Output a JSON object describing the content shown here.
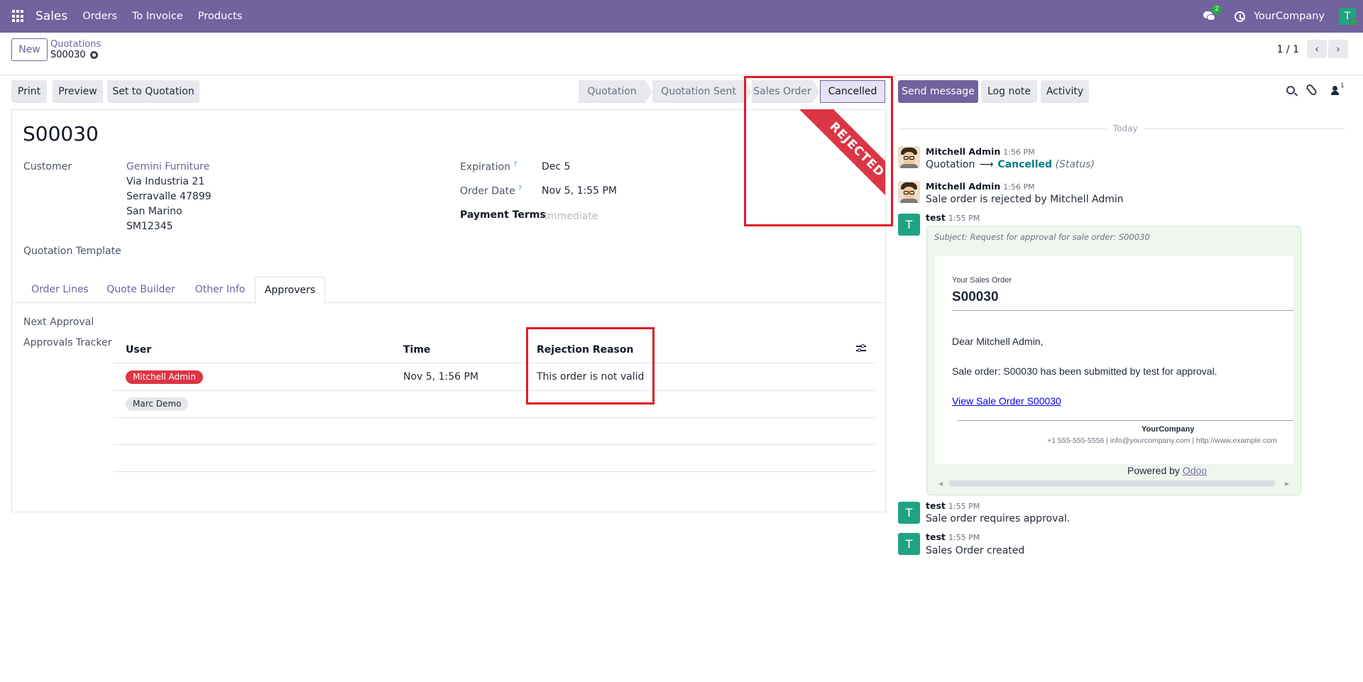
{
  "navbar": {
    "brand": "Sales",
    "items": [
      "Orders",
      "To Invoice",
      "Products"
    ],
    "chat_badge": "2",
    "company": "YourCompany",
    "avatar_letter": "T"
  },
  "control_panel": {
    "new_label": "New",
    "breadcrumb_parent": "Quotations",
    "breadcrumb_current": "S00030",
    "pager": "1 / 1",
    "prev_glyph": "‹",
    "next_glyph": "›"
  },
  "actions": {
    "print": "Print",
    "preview": "Preview",
    "set_to_quotation": "Set to Quotation"
  },
  "statusbar": {
    "stages": [
      "Quotation",
      "Quotation Sent",
      "Sales Order",
      "Cancelled"
    ],
    "active": "Cancelled"
  },
  "ribbon": "REJECTED",
  "form": {
    "title": "S00030",
    "customer_label": "Customer",
    "customer_name": "Gemini Furniture",
    "address_lines": [
      "Via Industria 21",
      "Serravalle 47899",
      "San Marino",
      "SM12345"
    ],
    "quotation_template_label": "Quotation Template",
    "expiration_label": "Expiration",
    "expiration_value": "Dec 5",
    "order_date_label": "Order Date",
    "order_date_value": "Nov 5, 1:55 PM",
    "help_mark": "?",
    "payment_terms_label": "Payment Terms",
    "payment_terms_placeholder": "Immediate"
  },
  "tabs": [
    "Order Lines",
    "Quote Builder",
    "Other Info",
    "Approvers"
  ],
  "approvers": {
    "next_approval_label": "Next Approval",
    "tracker_label": "Approvals Tracker",
    "columns": [
      "User",
      "Time",
      "Rejection Reason"
    ],
    "rows": [
      {
        "user": "Mitchell Admin",
        "time": "Nov 5, 1:56 PM",
        "reason": "This order is not valid",
        "rejected": true
      },
      {
        "user": "Marc Demo",
        "time": "",
        "reason": "",
        "rejected": false
      }
    ]
  },
  "chatter": {
    "send_message": "Send message",
    "log_note": "Log note",
    "activity": "Activity",
    "followers_count": "1",
    "today": "Today",
    "messages": [
      {
        "author": "Mitchell Admin",
        "time": "1:56 PM",
        "old": "Quotation",
        "arrow": "⟶",
        "new": "Cancelled",
        "field": "(Status)"
      },
      {
        "author": "Mitchell Admin",
        "time": "1:56 PM",
        "body": "Sale order is rejected by Mitchell Admin"
      },
      {
        "author": "test",
        "time": "1:55 PM",
        "subject": "Subject: Request for approval for sale order: S00030"
      },
      {
        "author": "test",
        "time": "1:55 PM",
        "body": "Sale order requires approval."
      },
      {
        "author": "test",
        "time": "1:55 PM",
        "body": "Sales Order created"
      }
    ],
    "mail": {
      "small": "Your Sales Order",
      "so": "S00030",
      "greeting": "Dear Mitchell Admin,",
      "line": "Sale order: S00030 has been submitted by test for approval.",
      "link": "View Sale Order S00030",
      "company": "YourCompany",
      "contact": "+1 555-555-5556 | info@yourcompany.com | http://www.example.com",
      "powered_by": "Powered by",
      "odoo": "Odoo",
      "scroll_left": "◀",
      "scroll_right": "▶"
    },
    "avatar_letter": "T"
  },
  "colors": {
    "brand": "#71639e",
    "danger": "#dc3545",
    "highlight": "#e01b24",
    "teal": "#1fa483"
  }
}
